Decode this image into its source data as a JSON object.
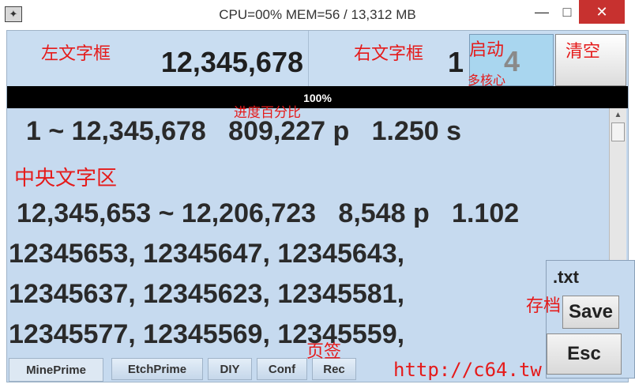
{
  "window": {
    "title": "CPU=00%   MEM=56 / 13,312 MB",
    "minimize": "—",
    "maximize": "□",
    "close": "✕"
  },
  "left_field": {
    "value": "12,345,678"
  },
  "right_field": {
    "value": "1"
  },
  "start_button": {
    "digit": "4"
  },
  "progress": {
    "percent": 100,
    "text": "100%"
  },
  "central": {
    "lines": [
      "1 ~ 12,345,678   809,227 p   1.250 s",
      "12,345,653 ~ 12,206,723   8,548 p   1.102",
      "12345653, 12345647, 12345643,",
      "12345637, 12345623, 12345581,",
      "12345577, 12345569, 12345559,"
    ]
  },
  "save_panel": {
    "extension": ".txt",
    "save_label": "Save",
    "esc_label": "Esc"
  },
  "tabs": [
    "MinePrime",
    "EtchPrime",
    "DIY",
    "Conf",
    "Rec"
  ],
  "annotations": {
    "left_field": "左文字框",
    "right_field": "右文字框",
    "start": "启动",
    "multicore": "多核心",
    "clear": "清空",
    "progress": "进度百分比",
    "central": "中央文字区",
    "save": "存档",
    "tabs": "页签",
    "url": "http://c64.tw"
  },
  "colors": {
    "panel_bg": "#c6daef",
    "start_bg": "#a9d6ef",
    "progress_bg": "#000000",
    "annotation": "#e51a1a",
    "close_btn": "#c7312f"
  }
}
